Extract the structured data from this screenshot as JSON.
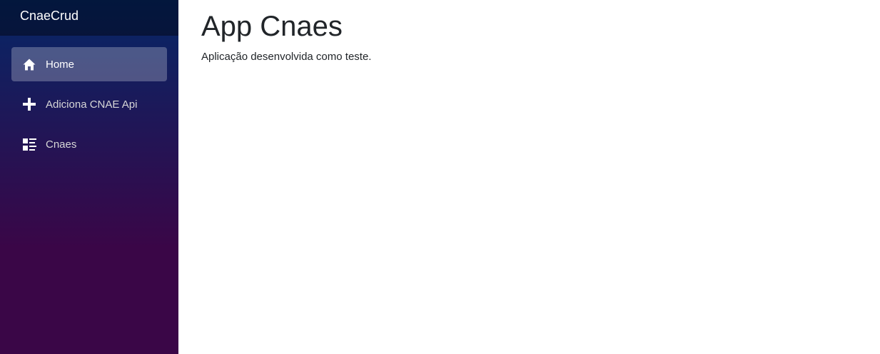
{
  "sidebar": {
    "brand": "CnaeCrud",
    "items": [
      {
        "label": "Home",
        "icon": "home-icon",
        "active": true
      },
      {
        "label": "Adiciona CNAE Api",
        "icon": "plus-icon",
        "active": false
      },
      {
        "label": "Cnaes",
        "icon": "list-icon",
        "active": false
      }
    ]
  },
  "main": {
    "title": "App Cnaes",
    "description": "Aplicação desenvolvida como teste."
  },
  "colors": {
    "sidebar_top": "#052767",
    "sidebar_bottom": "#3a0647",
    "text": "#212529"
  }
}
